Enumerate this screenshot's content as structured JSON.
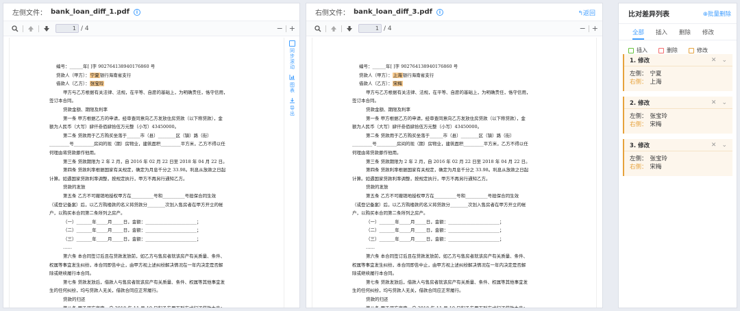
{
  "left_pane": {
    "file_label": "左侧文件：",
    "file_name": "bank_loan_diff_1.pdf",
    "page_current": "1",
    "page_total": "/ 4",
    "lines": [
      {
        "cls": "",
        "parts": [
          {
            "t": "编号：______年[ ]字 902764138940176860 号"
          }
        ]
      },
      {
        "cls": "",
        "parts": [
          {
            "t": "贷款人（甲方）："
          },
          {
            "t": "宁夏",
            "hl": true
          },
          {
            "t": "银行海南省支行"
          }
        ]
      },
      {
        "cls": "",
        "parts": [
          {
            "t": "借款人（乙方）："
          },
          {
            "t": "张宝玲",
            "hl": true
          }
        ]
      },
      {
        "cls": "in1",
        "parts": [
          {
            "t": "甲方与乙方根据有关法律、法规，在平等、自愿的基础上，为明确责任，恪守信用，"
          }
        ]
      },
      {
        "cls": "l0",
        "parts": [
          {
            "t": "签订本合同。"
          }
        ]
      },
      {
        "cls": "in1",
        "parts": [
          {
            "t": "贷款金额、期限及利率"
          }
        ]
      },
      {
        "cls": "in1",
        "parts": [
          {
            "t": "第一条 甲方根据乙方的申请，经审查同意向乙方发放住房贷款（以下称贷款），金"
          }
        ]
      },
      {
        "cls": "l0",
        "parts": [
          {
            "t": "额为人民币（大写）肆仟叁佰肆拾伍万元整（小写）43450000。"
          }
        ]
      },
      {
        "cls": "in1",
        "parts": [
          {
            "t": "第二条 贷款用于乙方购买坐落于______市（县）________区（镇）路（街）"
          }
        ]
      },
      {
        "cls": "l0",
        "parts": [
          {
            "t": "_________号_________房间的现（期）房物业，建筑面积_________平方米，乙方不得以任"
          }
        ]
      },
      {
        "cls": "l0",
        "parts": [
          {
            "t": "何理由将贷款挪作他用。"
          }
        ]
      },
      {
        "cls": "in1",
        "parts": [
          {
            "t": "第三条 贷款期限为 2 年 2 月，自 2016 年 02 月 22 日至 2018 年 04 月 22 日。"
          }
        ]
      },
      {
        "cls": "in1",
        "parts": [
          {
            "t": "第四条 贷款利率根据国家有关规定，确定为月息千分之 33.98。利息从放款之日起"
          }
        ]
      },
      {
        "cls": "l0",
        "parts": [
          {
            "t": "计算。如遇国家贷款利率调整，按规定执行，甲方不再另行通知乙方。"
          }
        ]
      },
      {
        "cls": "in1",
        "parts": [
          {
            "t": "贷款的发放"
          }
        ]
      },
      {
        "cls": "in1",
        "parts": [
          {
            "t": "第五条 乙方不可撤销地授权甲方在__________号和__________号担保合同生效"
          }
        ]
      },
      {
        "cls": "l0",
        "parts": [
          {
            "t": "（或登记备案）后，以乙方购楼款的名义将贷款分________次划入售房者在甲方开立的帐"
          }
        ]
      },
      {
        "cls": "l0",
        "parts": [
          {
            "t": "户，以购买本合同第二条所列之房产。"
          }
        ]
      },
      {
        "cls": "in1",
        "parts": [
          {
            "t": "（一）_______年_____月_____日，金额：_______________________；"
          }
        ]
      },
      {
        "cls": "in1",
        "parts": [
          {
            "t": "（二）_______年_____月_____日，金额：_______________________；"
          }
        ]
      },
      {
        "cls": "in1",
        "parts": [
          {
            "t": "（三）_______年_____月_____日，金额：_______________________；"
          }
        ]
      },
      {
        "cls": "in1",
        "parts": [
          {
            "t": "……"
          }
        ]
      },
      {
        "cls": "in1",
        "parts": [
          {
            "t": "第六条 本合同签订后且在贷款发放前，如乙方与售房者就该房产有关质量、条件、"
          }
        ]
      },
      {
        "cls": "l0",
        "parts": [
          {
            "t": "权属等事宜发生纠纷，本合同即告中止，由甲方视上述纠纷解决情况在一年内决定是否解"
          }
        ]
      },
      {
        "cls": "l0",
        "parts": [
          {
            "t": "除或继续履行本合同。"
          }
        ]
      },
      {
        "cls": "in1",
        "parts": [
          {
            "t": "第七条 贷款发放后，借款人与售房者就该房产有关质量、条件、权属等其他事宜发"
          }
        ]
      },
      {
        "cls": "l0",
        "parts": [
          {
            "t": "生的任何纠纷，均与贷款人无关，借款合同应正常履行。"
          }
        ]
      },
      {
        "cls": "in1",
        "parts": [
          {
            "t": "贷款的归还"
          }
        ]
      },
      {
        "cls": "in1",
        "parts": [
          {
            "t": "第八条 甲乙双方商定，自 2018 年 11 月 10 日起乙方用下列方式归还贷款本息："
          }
        ]
      }
    ]
  },
  "right_pane": {
    "file_label": "右侧文件：",
    "file_name": "bank_loan_diff_3.pdf",
    "back_label": "↰返回",
    "page_current": "1",
    "page_total": "/ 4",
    "lines": [
      {
        "cls": "",
        "parts": [
          {
            "t": "编号：______年[ ]字 902764138940176860 号"
          }
        ]
      },
      {
        "cls": "",
        "parts": [
          {
            "t": "贷款人（甲方）："
          },
          {
            "t": "上海",
            "hl": true
          },
          {
            "t": "银行海南省支行"
          }
        ]
      },
      {
        "cls": "",
        "parts": [
          {
            "t": "借款人（乙方）："
          },
          {
            "t": "宋梅",
            "hl": true
          }
        ]
      },
      {
        "cls": "in1",
        "parts": [
          {
            "t": "甲方与乙方根据有关法律、法规，在平等、自愿的基础上，为明确责任，恪守信用，"
          }
        ]
      },
      {
        "cls": "l0",
        "parts": [
          {
            "t": "签订本合同。"
          }
        ]
      },
      {
        "cls": "in1",
        "parts": [
          {
            "t": "贷款金额、期限及利率"
          }
        ]
      },
      {
        "cls": "in1",
        "parts": [
          {
            "t": "第一条 甲方根据乙方的申请，经审查同意向乙方发放住房贷款（以下称贷款），金"
          }
        ]
      },
      {
        "cls": "l0",
        "parts": [
          {
            "t": "额为人民币（大写）肆仟叁佰肆拾伍万元整（小写）43450000。"
          }
        ]
      },
      {
        "cls": "in1",
        "parts": [
          {
            "t": "第二条 贷款用于乙方购买坐落于______市（县）________区（镇）路（街）"
          }
        ]
      },
      {
        "cls": "l0",
        "parts": [
          {
            "t": "_________号_________房间的现（期）房物业，建筑面积_________平方米，乙方不得以任"
          }
        ]
      },
      {
        "cls": "l0",
        "parts": [
          {
            "t": "何理由将贷款挪作他用。"
          }
        ]
      },
      {
        "cls": "in1",
        "parts": [
          {
            "t": "第三条 贷款期限为 2 年 2 月，自 2016 年 02 月 22 日至 2018 年 04 月 22 日。"
          }
        ]
      },
      {
        "cls": "in1",
        "parts": [
          {
            "t": "第四条 贷款利率根据国家有关规定，确定为月息千分之 33.98。利息从放款之日起"
          }
        ]
      },
      {
        "cls": "l0",
        "parts": [
          {
            "t": "计算。如遇国家贷款利率调整，按规定执行，甲方不再另行通知乙方。"
          }
        ]
      },
      {
        "cls": "in1",
        "parts": [
          {
            "t": "贷款的发放"
          }
        ]
      },
      {
        "cls": "in1",
        "parts": [
          {
            "t": "第五条 乙方不可撤销地授权甲方在__________号和__________号担保合同生效"
          }
        ]
      },
      {
        "cls": "l0",
        "parts": [
          {
            "t": "（或登记备案）后，以乙方购楼款的名义将贷款分________次划入售房者在甲方开立的帐"
          }
        ]
      },
      {
        "cls": "l0",
        "parts": [
          {
            "t": "户，以购买本合同第二条所列之房产。"
          }
        ]
      },
      {
        "cls": "in1",
        "parts": [
          {
            "t": "（一）_______年_____月_____日，金额：_______________________；"
          }
        ]
      },
      {
        "cls": "in1",
        "parts": [
          {
            "t": "（二）_______年_____月_____日，金额：_______________________；"
          }
        ]
      },
      {
        "cls": "in1",
        "parts": [
          {
            "t": "（三）_______年_____月_____日，金额：_______________________；"
          }
        ]
      },
      {
        "cls": "in1",
        "parts": [
          {
            "t": "……"
          }
        ]
      },
      {
        "cls": "in1",
        "parts": [
          {
            "t": "第六条 本合同签订后且在贷款发放前，如乙方与售房者就该房产有关质量、条件、"
          }
        ]
      },
      {
        "cls": "l0",
        "parts": [
          {
            "t": "权属等事宜发生纠纷，本合同即告中止，由甲方视上述纠纷解决情况在一年内决定是否解"
          }
        ]
      },
      {
        "cls": "l0",
        "parts": [
          {
            "t": "除或继续履行本合同。"
          }
        ]
      },
      {
        "cls": "in1",
        "parts": [
          {
            "t": "第七条 贷款发放后，借款人与售房者就该房产有关质量、条件、权属等其他事宜发"
          }
        ]
      },
      {
        "cls": "l0",
        "parts": [
          {
            "t": "生的任何纠纷，均与贷款人无关，借款合同应正常履行。"
          }
        ]
      },
      {
        "cls": "in1",
        "parts": [
          {
            "t": "贷款的归还"
          }
        ]
      },
      {
        "cls": "in1",
        "parts": [
          {
            "t": "第八条 甲乙双方商定，自 2018 年 11 月 10 日起乙方用下列方式归还贷款本息："
          }
        ]
      }
    ]
  },
  "side_tools": {
    "sync_scroll": "同步滚动",
    "chart": "图表",
    "export": "导出"
  },
  "diff_panel": {
    "title": "比对差异列表",
    "batch_delete": "⊕批量删除",
    "tabs": [
      "全部",
      "插入",
      "删除",
      "修改"
    ],
    "active_tab": 0,
    "legend": [
      {
        "label": "插入",
        "color": "#67c23a"
      },
      {
        "label": "删除",
        "color": "#f56c6c"
      },
      {
        "label": "修改",
        "color": "#e6a23c"
      }
    ],
    "left_key": "左侧：",
    "right_key": "右侧：",
    "items": [
      {
        "title": "1. 修改",
        "left": "宁夏",
        "right": "上海"
      },
      {
        "title": "2. 修改",
        "left": "张宝玲",
        "right": "宋梅"
      },
      {
        "title": "3. 修改",
        "left": "张宝玲",
        "right": "宋梅"
      }
    ]
  },
  "colors": {
    "accent": "#409eff",
    "modify": "#e6a23c",
    "highlight": "#f5c88c"
  }
}
